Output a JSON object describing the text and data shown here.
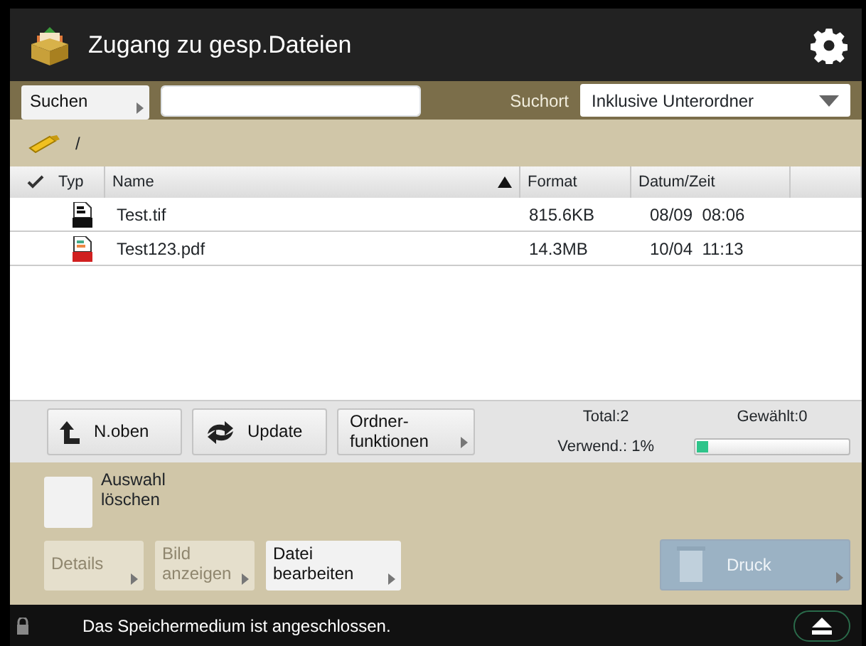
{
  "window": {
    "title": "Zugang zu gesp.Dateien"
  },
  "search": {
    "button": "Suchen",
    "location_label": "Suchort",
    "location_value": "Inklusive Unterordner"
  },
  "path": "/",
  "table": {
    "columns": [
      {
        "label": "Typ",
        "kind": "check"
      },
      {
        "label": "Name",
        "sorted": true
      },
      {
        "label": "Format",
        "sorted": false
      },
      {
        "label": "Datum/Zeit",
        "sorted": false
      }
    ],
    "rows": [
      {
        "kind": "tif",
        "name": "Test.tif",
        "format": "815.6KB",
        "datetime": "08/09  08:06"
      },
      {
        "kind": "pdf",
        "name": "Test123.pdf",
        "format": "14.3MB",
        "datetime": "10/04  11:13"
      }
    ]
  },
  "toolbar": {
    "buttons": [
      {
        "kind": "up",
        "label": "N.oben",
        "menu": false
      },
      {
        "kind": "refresh",
        "label": "Update",
        "menu": false
      },
      {
        "kind": "text",
        "label": "Ordner-\nfunktionen",
        "menu": true
      }
    ],
    "total": "Total:2",
    "used": "Verwend.: 1%",
    "selected": "Gewählt:0",
    "level": 0.08
  },
  "clear_selection": {
    "label": "Auswahl\nlöschen",
    "checked": false
  },
  "actions": [
    {
      "label": "Details",
      "disabled": true
    },
    {
      "label": "Bild\nanzeigen",
      "disabled": true
    },
    {
      "label": "Datei\nbearbeiten",
      "disabled": false
    }
  ],
  "print_button": {
    "label": "Druck",
    "disabled": true
  },
  "status_bar": {
    "text": "Das Speichermedium ist angeschlossen."
  }
}
